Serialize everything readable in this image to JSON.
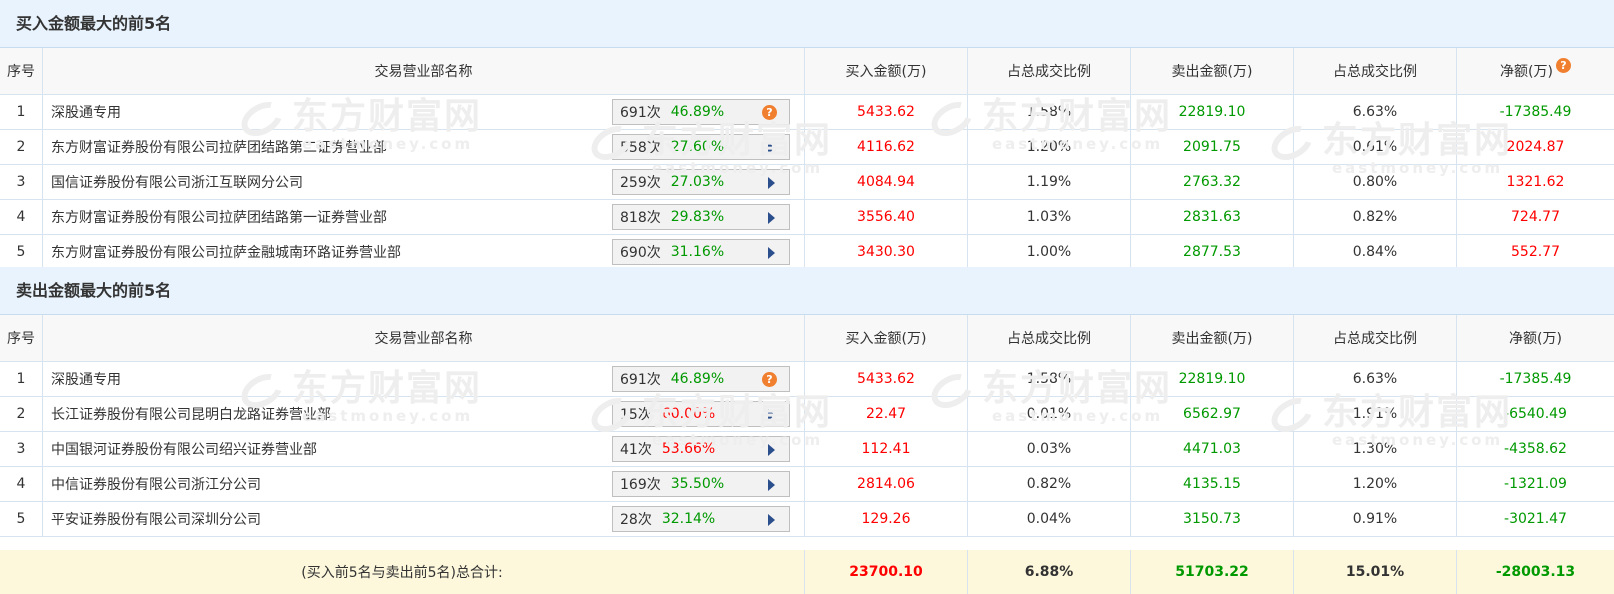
{
  "buy_section": {
    "title": "买入金额最大的前5名",
    "headers": {
      "rank": "序号",
      "branch": "交易营业部名称",
      "buy": "买入金额(万)",
      "buy_ratio": "占总成交比例",
      "sell": "卖出金额(万)",
      "sell_ratio": "占总成交比例",
      "net": "净额(万)",
      "net_help_icon": "?"
    },
    "rows": [
      {
        "rank": "1",
        "branch": "深股通专用",
        "count": "691次",
        "pct": "46.89%",
        "pct_color": "green",
        "action": "info",
        "icon_text": "?",
        "buy": "5433.62",
        "buy_ratio": "1.58%",
        "sell": "22819.10",
        "sell_ratio": "6.63%",
        "net": "-17385.49",
        "net_color": "green"
      },
      {
        "rank": "2",
        "branch": "东方财富证券股份有限公司拉萨团结路第二证券营业部",
        "count": "558次",
        "pct": "27.60%",
        "pct_color": "green",
        "action": "play",
        "icon_text": "",
        "buy": "4116.62",
        "buy_ratio": "1.20%",
        "sell": "2091.75",
        "sell_ratio": "0.61%",
        "net": "2024.87",
        "net_color": "red"
      },
      {
        "rank": "3",
        "branch": "国信证券股份有限公司浙江互联网分公司",
        "count": "259次",
        "pct": "27.03%",
        "pct_color": "green",
        "action": "play",
        "icon_text": "",
        "buy": "4084.94",
        "buy_ratio": "1.19%",
        "sell": "2763.32",
        "sell_ratio": "0.80%",
        "net": "1321.62",
        "net_color": "red"
      },
      {
        "rank": "4",
        "branch": "东方财富证券股份有限公司拉萨团结路第一证券营业部",
        "count": "818次",
        "pct": "29.83%",
        "pct_color": "green",
        "action": "play",
        "icon_text": "",
        "buy": "3556.40",
        "buy_ratio": "1.03%",
        "sell": "2831.63",
        "sell_ratio": "0.82%",
        "net": "724.77",
        "net_color": "red"
      },
      {
        "rank": "5",
        "branch": "东方财富证券股份有限公司拉萨金融城南环路证券营业部",
        "count": "690次",
        "pct": "31.16%",
        "pct_color": "green",
        "action": "play",
        "icon_text": "",
        "buy": "3430.30",
        "buy_ratio": "1.00%",
        "sell": "2877.53",
        "sell_ratio": "0.84%",
        "net": "552.77",
        "net_color": "red"
      }
    ]
  },
  "sell_section": {
    "title": "卖出金额最大的前5名",
    "headers": {
      "rank": "序号",
      "branch": "交易营业部名称",
      "buy": "买入金额(万)",
      "buy_ratio": "占总成交比例",
      "sell": "卖出金额(万)",
      "sell_ratio": "占总成交比例",
      "net": "净额(万)"
    },
    "rows": [
      {
        "rank": "1",
        "branch": "深股通专用",
        "count": "691次",
        "pct": "46.89%",
        "pct_color": "green",
        "action": "info",
        "icon_text": "?",
        "buy": "5433.62",
        "buy_ratio": "1.58%",
        "sell": "22819.10",
        "sell_ratio": "6.63%",
        "net": "-17385.49",
        "net_color": "green"
      },
      {
        "rank": "2",
        "branch": "长江证券股份有限公司昆明白龙路证券营业部",
        "count": "15次",
        "pct": "60.00%",
        "pct_color": "red",
        "action": "play",
        "icon_text": "",
        "buy": "22.47",
        "buy_ratio": "0.01%",
        "sell": "6562.97",
        "sell_ratio": "1.91%",
        "net": "-6540.49",
        "net_color": "green"
      },
      {
        "rank": "3",
        "branch": "中国银河证券股份有限公司绍兴证券营业部",
        "count": "41次",
        "pct": "53.66%",
        "pct_color": "red",
        "action": "play",
        "icon_text": "",
        "buy": "112.41",
        "buy_ratio": "0.03%",
        "sell": "4471.03",
        "sell_ratio": "1.30%",
        "net": "-4358.62",
        "net_color": "green"
      },
      {
        "rank": "4",
        "branch": "中信证券股份有限公司浙江分公司",
        "count": "169次",
        "pct": "35.50%",
        "pct_color": "green",
        "action": "play",
        "icon_text": "",
        "buy": "2814.06",
        "buy_ratio": "0.82%",
        "sell": "4135.15",
        "sell_ratio": "1.20%",
        "net": "-1321.09",
        "net_color": "green"
      },
      {
        "rank": "5",
        "branch": "平安证券股份有限公司深圳分公司",
        "count": "28次",
        "pct": "32.14%",
        "pct_color": "green",
        "action": "play",
        "icon_text": "",
        "buy": "129.26",
        "buy_ratio": "0.04%",
        "sell": "3150.73",
        "sell_ratio": "0.91%",
        "net": "-3021.47",
        "net_color": "green"
      }
    ]
  },
  "total": {
    "label": "(买入前5名与卖出前5名)总合计:",
    "buy": "23700.10",
    "buy_ratio": "6.88%",
    "sell": "51703.22",
    "sell_ratio": "15.01%",
    "net": "-28003.13"
  },
  "watermark": {
    "brand": "东方财富网",
    "domain": "eastmoney.com"
  },
  "colors": {
    "up": "#ff0000",
    "down": "#009900",
    "header_bg": "#e8f3fd",
    "total_bg": "#fdf8dc",
    "border": "#d7e4ef",
    "help_icon": "#f08030",
    "play_icon": "#2b4f8c"
  }
}
